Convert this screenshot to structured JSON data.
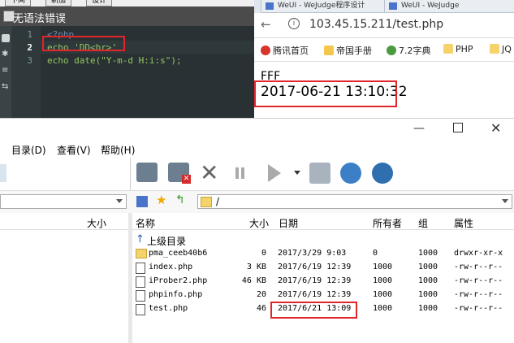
{
  "editor": {
    "top_buttons": [
      "下间",
      "新加",
      "设计"
    ],
    "status_text": "无语法错误",
    "lines": [
      {
        "num": "1",
        "code": "<?php"
      },
      {
        "num": "2",
        "code": "echo 'DD<br>'"
      },
      {
        "num": "3",
        "code": "echo date(\"Y-m-d H:i:s\");"
      }
    ],
    "colors": {
      "bg": "#293134",
      "keyword": "#93c763",
      "string": "#ec7600",
      "tag": "#678cb1"
    }
  },
  "browser": {
    "tabs": [
      "WeUI - WeJudge程序设计",
      "WeUI - WeJudge"
    ],
    "url": "103.45.15.211/test.php",
    "bookmarks": [
      "腾讯首页",
      "帝国手册",
      "7.2字典",
      "PHP",
      "JQ"
    ],
    "content": {
      "line1": "FFF",
      "line2": "2017-06-21 13:10:32"
    }
  },
  "ftp": {
    "menus": [
      "目录(D)",
      "查看(V)",
      "帮助(H)"
    ],
    "left_header": {
      "size": "大小"
    },
    "path": "/",
    "columns": {
      "name": "名称",
      "size": "大小",
      "date": "日期",
      "owner": "所有者",
      "group": "组",
      "attr": "属性"
    },
    "up_dir": "上级目录",
    "files": [
      {
        "name": "pma_ceeb40b6",
        "size": "0",
        "date": "2017/3/29 9:03",
        "owner": "0",
        "group": "1000",
        "attr": "drwxr-xr-x",
        "type": "folder"
      },
      {
        "name": "index.php",
        "size": "3 KB",
        "date": "2017/6/19 12:39",
        "owner": "1000",
        "group": "1000",
        "attr": "-rw-r--r--",
        "type": "file"
      },
      {
        "name": "iProber2.php",
        "size": "46 KB",
        "date": "2017/6/19 12:39",
        "owner": "1000",
        "group": "1000",
        "attr": "-rw-r--r--",
        "type": "file"
      },
      {
        "name": "phpinfo.php",
        "size": "20",
        "date": "2017/6/19 12:39",
        "owner": "1000",
        "group": "1000",
        "attr": "-rw-r--r--",
        "type": "file"
      },
      {
        "name": "test.php",
        "size": "46",
        "date": "2017/6/21 13:09",
        "owner": "1000",
        "group": "1000",
        "attr": "-rw-r--r--",
        "type": "file"
      }
    ]
  },
  "colors": {
    "highlight": "#e0252b"
  }
}
